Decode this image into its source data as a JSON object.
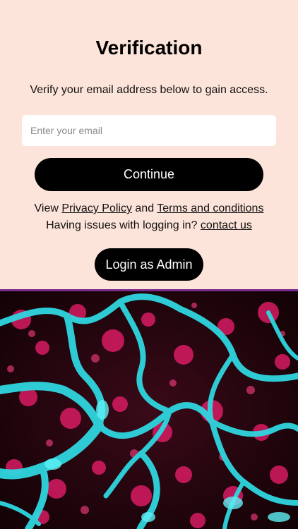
{
  "verification": {
    "title": "Verification",
    "subtitle": "Verify your email address below to gain access."
  },
  "email_input": {
    "value": "",
    "placeholder": "Enter your email"
  },
  "continue_button": {
    "label": "Continue"
  },
  "legal": {
    "view_text": "View",
    "privacy_link": "Privacy Policy",
    "and_text": "and",
    "terms_link": "Terms and conditions",
    "issues_text": "Having issues with logging in?",
    "contact_link": "contact us"
  },
  "admin_button": {
    "label": "Login as Admin"
  },
  "colors": {
    "background": "#fde4da",
    "button": "#000000",
    "divider": "#7a2a8c",
    "cyan_cells": "#2fd6e0",
    "magenta_cells": "#e0206a"
  }
}
